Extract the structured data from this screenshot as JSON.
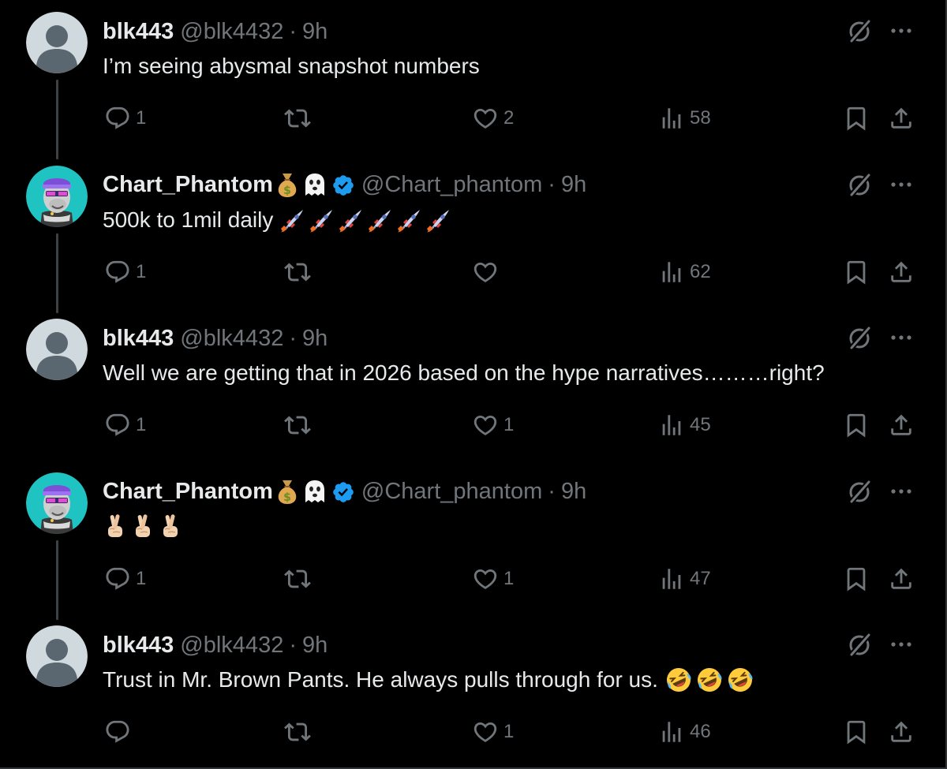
{
  "tweets": [
    {
      "avatar": "default-avatar",
      "name": "blk443",
      "handle": "@blk4432",
      "time": "9h",
      "verified": false,
      "text": "I’m seeing abysmal snapshot numbers",
      "text_emojis": [],
      "replies": "1",
      "retweets": "",
      "likes": "2",
      "views": "58",
      "connector_below": true
    },
    {
      "avatar": "ape-avatar",
      "name": "Chart_Phantom",
      "handle": "@Chart_phantom",
      "time": "9h",
      "verified": true,
      "name_emojis": [
        "money-bag",
        "ghost"
      ],
      "text": "500k to 1mil daily",
      "text_emojis": [
        "rocket",
        "rocket",
        "rocket",
        "rocket",
        "rocket",
        "rocket"
      ],
      "replies": "1",
      "retweets": "",
      "likes": "",
      "views": "62",
      "connector_below": true
    },
    {
      "avatar": "default-avatar",
      "name": "blk443",
      "handle": "@blk4432",
      "time": "9h",
      "verified": false,
      "text": "Well we are getting that in 2026 based on the hype narratives………right?",
      "text_emojis": [],
      "replies": "1",
      "retweets": "",
      "likes": "1",
      "views": "45",
      "connector_below": false
    },
    {
      "avatar": "ape-avatar",
      "name": "Chart_Phantom",
      "handle": "@Chart_phantom",
      "time": "9h",
      "verified": true,
      "name_emojis": [
        "money-bag",
        "ghost"
      ],
      "text": "",
      "text_emojis": [
        "crossed-fingers",
        "crossed-fingers",
        "crossed-fingers"
      ],
      "replies": "1",
      "retweets": "",
      "likes": "1",
      "views": "47",
      "connector_below": true
    },
    {
      "avatar": "default-avatar",
      "name": "blk443",
      "handle": "@blk4432",
      "time": "9h",
      "verified": false,
      "text": "Trust in Mr. Brown Pants. He always pulls through for us.",
      "text_emojis": [
        "rolling-on-floor-laughing",
        "rolling-on-floor-laughing",
        "rolling-on-floor-laughing"
      ],
      "replies": "",
      "retweets": "",
      "likes": "1",
      "views": "46",
      "connector_below": false
    }
  ],
  "separator": "·",
  "colors": {
    "background": "#000000",
    "text": "#e7e9ea",
    "secondary": "#71767b",
    "verified": "#1d9bf0",
    "connector": "#3e4144",
    "avatar_default": "#cfd9de",
    "ape_background": "#1fc3c1"
  },
  "icons": [
    "reply-icon",
    "retweet-icon",
    "like-icon",
    "views-icon",
    "bookmark-icon",
    "share-icon",
    "grok-icon",
    "more-icon",
    "verified-badge-icon"
  ]
}
